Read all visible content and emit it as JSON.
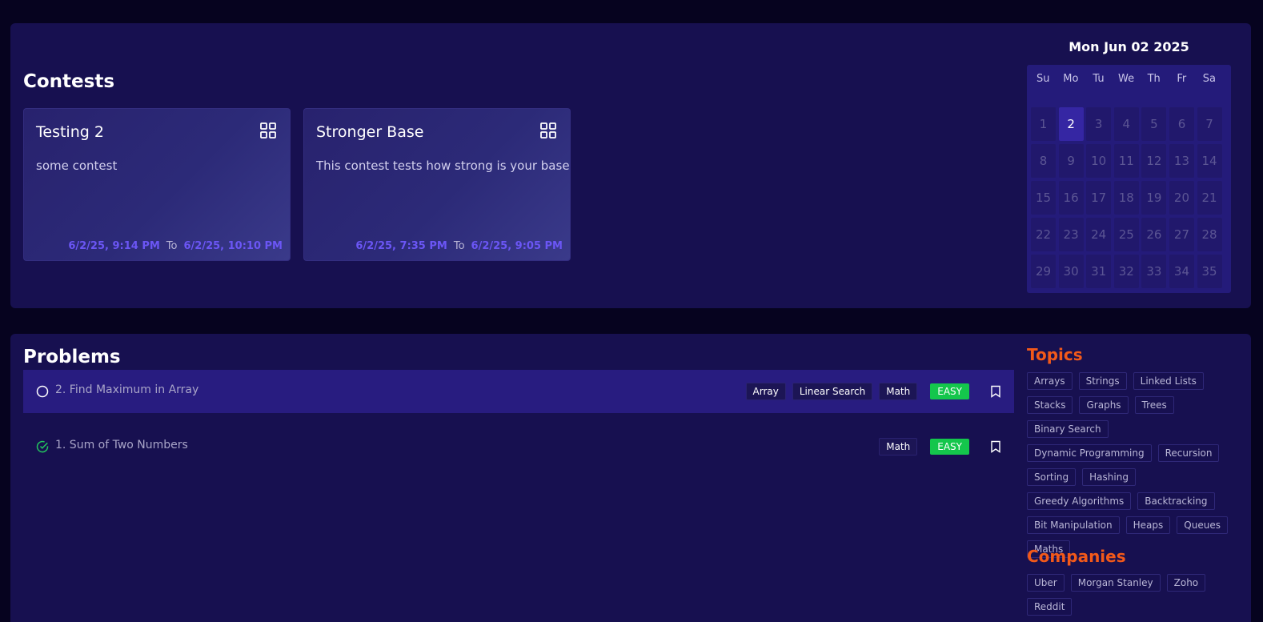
{
  "contests": {
    "title": "Contests",
    "cards": [
      {
        "title": "Testing 2",
        "description": "some contest",
        "start": "6/2/25, 9:14 PM",
        "to": "To",
        "end": "6/2/25, 10:10 PM"
      },
      {
        "title": "Stronger Base",
        "description": "This contest tests how strong is your base",
        "start": "6/2/25, 7:35 PM",
        "to": "To",
        "end": "6/2/25, 9:05 PM"
      }
    ]
  },
  "calendar": {
    "date_label": "Mon Jun 02 2025",
    "weekdays": [
      "Su",
      "Mo",
      "Tu",
      "We",
      "Th",
      "Fr",
      "Sa"
    ],
    "days": [
      "1",
      "2",
      "3",
      "4",
      "5",
      "6",
      "7",
      "8",
      "9",
      "10",
      "11",
      "12",
      "13",
      "14",
      "15",
      "16",
      "17",
      "18",
      "19",
      "20",
      "21",
      "22",
      "23",
      "24",
      "25",
      "26",
      "27",
      "28",
      "29",
      "30",
      "31",
      "32",
      "33",
      "34",
      "35"
    ],
    "selected_day": "2"
  },
  "problems": {
    "title": "Problems",
    "rows": [
      {
        "title": "2. Find Maximum in Array",
        "status": "unsolved",
        "tags": [
          "Array",
          "Linear Search",
          "Math"
        ],
        "difficulty": "EASY"
      },
      {
        "title": "1. Sum of Two Numbers",
        "status": "solved",
        "tags": [
          "Math"
        ],
        "difficulty": "EASY"
      }
    ]
  },
  "sidebar": {
    "topics_title": "Topics",
    "topics": [
      "Arrays",
      "Strings",
      "Linked Lists",
      "Stacks",
      "Graphs",
      "Trees",
      "Binary Search",
      "Dynamic Programming",
      "Recursion",
      "Sorting",
      "Hashing",
      "Greedy Algorithms",
      "Backtracking",
      "Bit Manipulation",
      "Heaps",
      "Queues",
      "Maths"
    ],
    "companies_title": "Companies",
    "companies": [
      "Uber",
      "Morgan Stanley",
      "Zoho",
      "Reddit"
    ]
  },
  "colors": {
    "accent_orange": "#f2591a",
    "date_purple": "#6b56f5",
    "easy_green": "#14c64c",
    "solved_green": "#22c55e"
  }
}
